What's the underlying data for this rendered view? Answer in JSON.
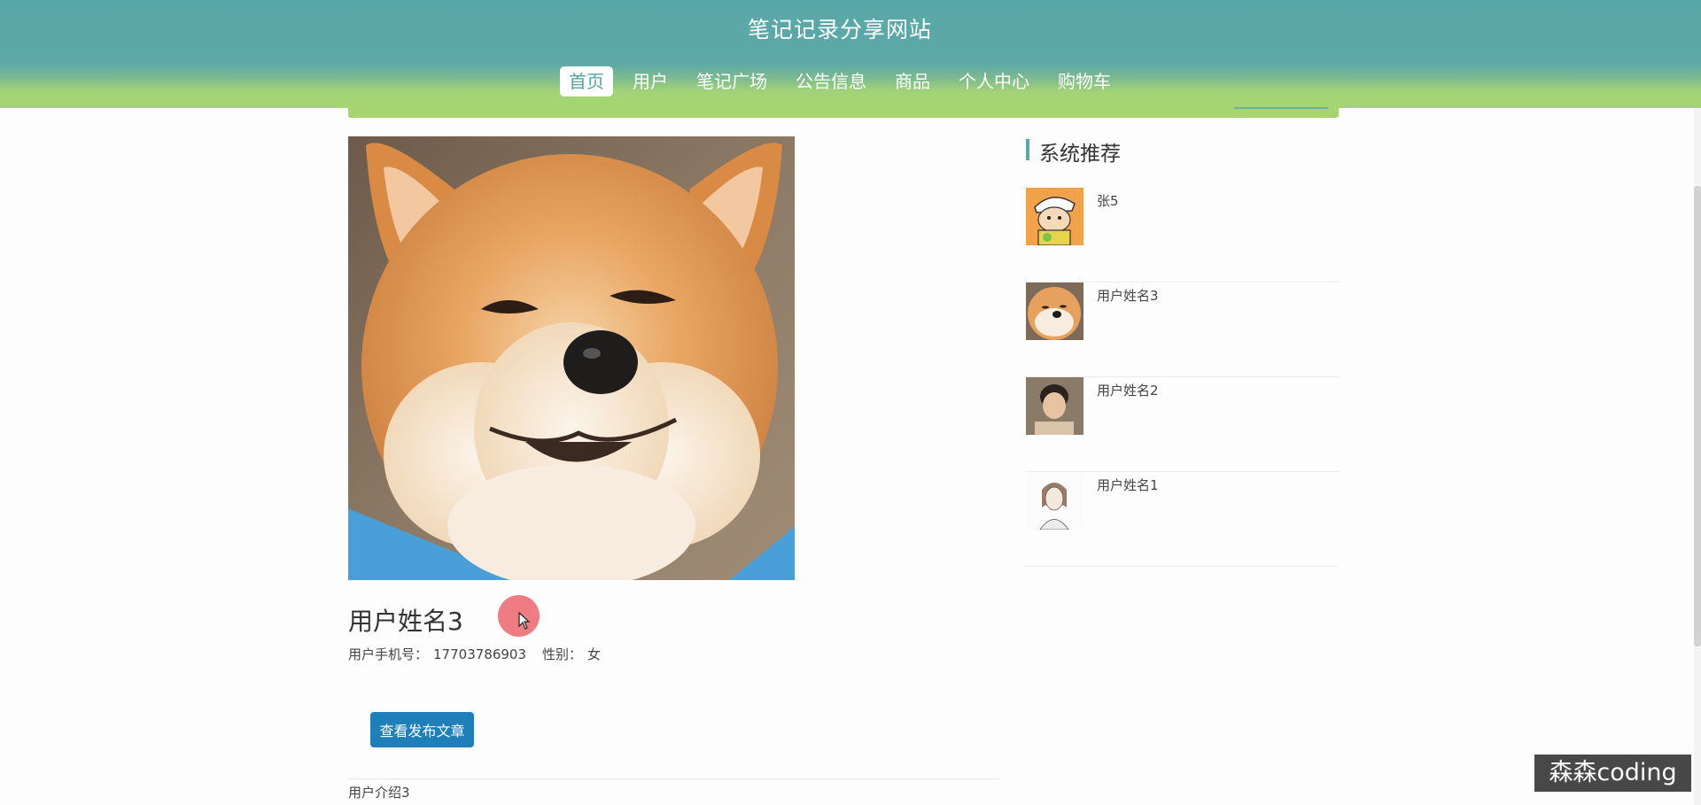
{
  "site": {
    "title": "笔记记录分享网站"
  },
  "nav": {
    "items": [
      {
        "label": "首页",
        "active": true
      },
      {
        "label": "用户",
        "active": false
      },
      {
        "label": "笔记广场",
        "active": false
      },
      {
        "label": "公告信息",
        "active": false
      },
      {
        "label": "商品",
        "active": false
      },
      {
        "label": "个人中心",
        "active": false
      },
      {
        "label": "购物车",
        "active": false
      }
    ]
  },
  "profile": {
    "name": "用户姓名3",
    "phone_label": "用户手机号：",
    "phone": "17703786903",
    "gender_label": "性别：",
    "gender": "女",
    "view_button": "查看发布文章",
    "intro": "用户介绍3"
  },
  "recommend": {
    "title": "系统推荐",
    "items": [
      {
        "name": "张5",
        "avatar": "cartoon-boy-avatar"
      },
      {
        "name": "用户姓名3",
        "avatar": "shiba-dog-avatar"
      },
      {
        "name": "用户姓名2",
        "avatar": "young-man-avatar"
      },
      {
        "name": "用户姓名1",
        "avatar": "sketch-girl-avatar"
      }
    ]
  },
  "overlay": {
    "watermark": "森森coding"
  },
  "colors": {
    "header_top": "#58a7a8",
    "header_bottom": "#a6d470",
    "button": "#1f7fb8",
    "accent_bar": "#5da7a9"
  }
}
